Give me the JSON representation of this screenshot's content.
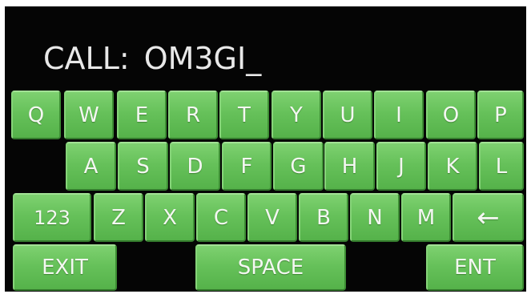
{
  "display": {
    "call_label": "CALL:",
    "call_value": "OM3GI",
    "cursor": "_"
  },
  "keyboard": {
    "row1": [
      "Q",
      "W",
      "E",
      "R",
      "T",
      "Y",
      "U",
      "I",
      "O",
      "P"
    ],
    "row2": [
      "A",
      "S",
      "D",
      "F",
      "G",
      "H",
      "J",
      "K",
      "L"
    ],
    "row3": [
      "Z",
      "X",
      "C",
      "V",
      "B",
      "N",
      "M"
    ],
    "numbers_label": "123",
    "backspace_icon": "left-arrow-icon",
    "exit_label": "EXIT",
    "space_label": "SPACE",
    "enter_label": "ENT"
  },
  "colors": {
    "key_green": "#66c15a",
    "background": "#050505",
    "text": "#e8e8e8"
  }
}
